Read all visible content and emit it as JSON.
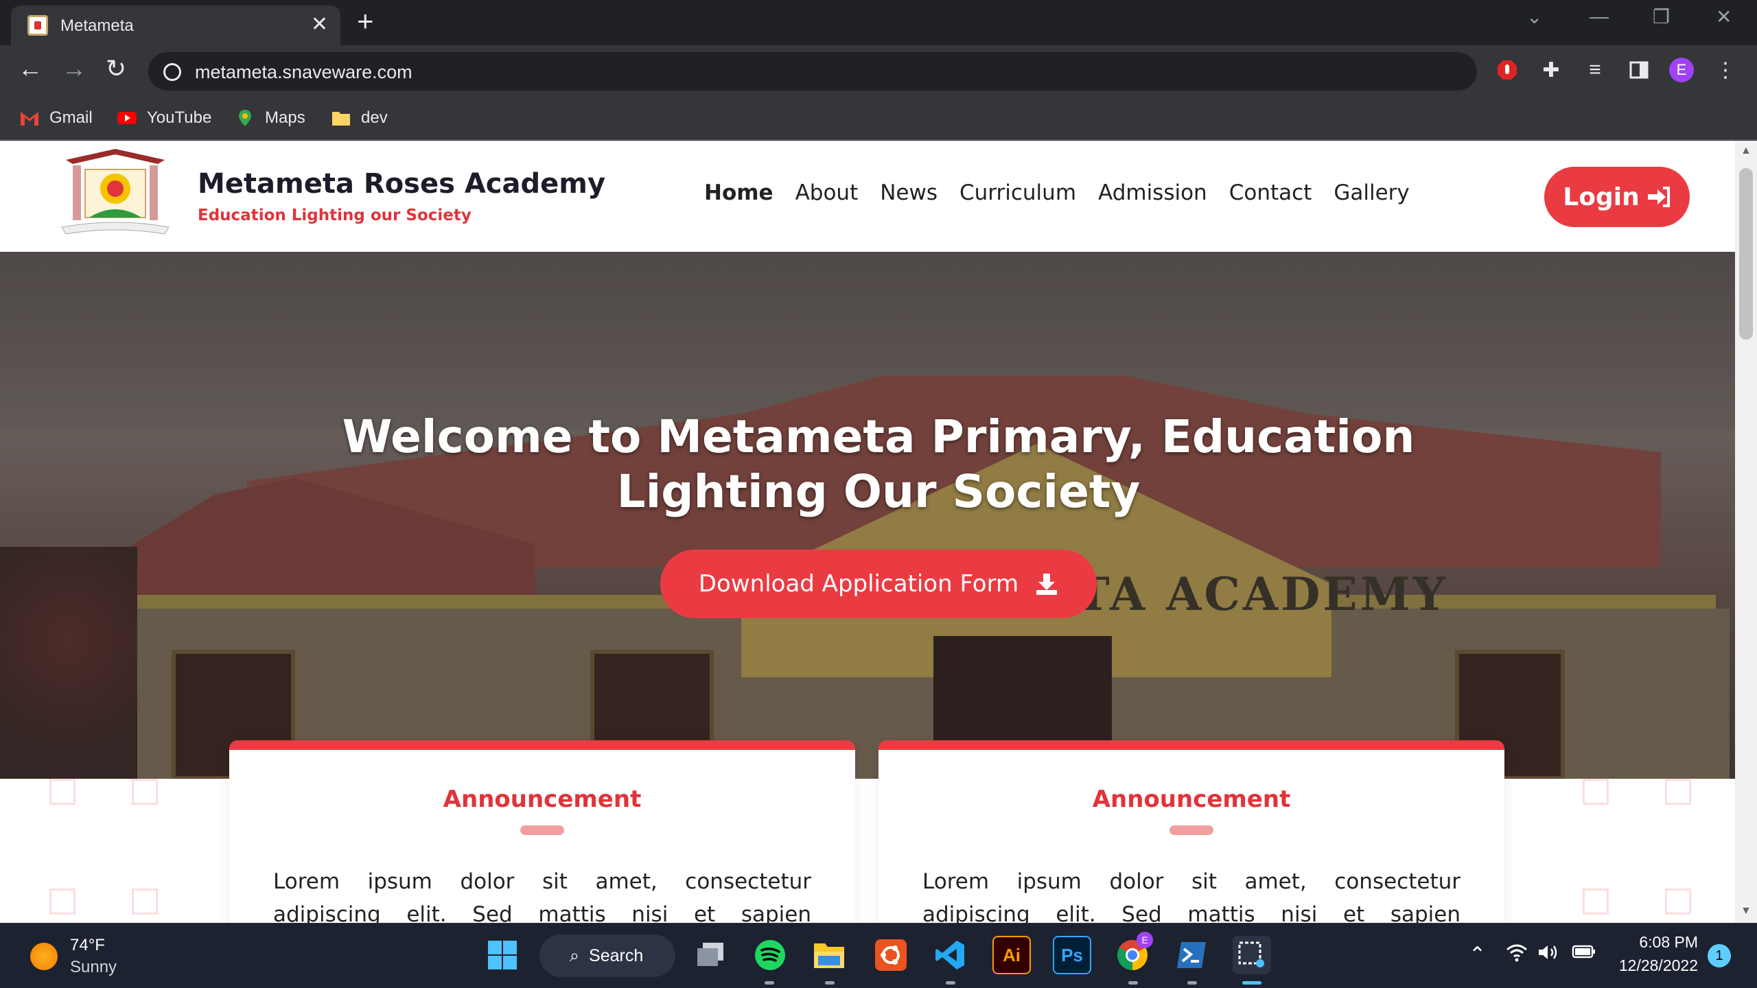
{
  "browser": {
    "tab_title": "Metameta",
    "url": "metameta.snaveware.com",
    "profile_initial": "E",
    "bookmarks": [
      {
        "label": "Gmail",
        "icon": "gmail-icon"
      },
      {
        "label": "YouTube",
        "icon": "youtube-icon"
      },
      {
        "label": "Maps",
        "icon": "maps-icon"
      },
      {
        "label": "dev",
        "icon": "folder-icon"
      }
    ]
  },
  "site": {
    "brand_name": "Metameta Roses Academy",
    "tagline": "Education Lighting our Society",
    "nav": [
      "Home",
      "About",
      "News",
      "Curriculum",
      "Admission",
      "Contact",
      "Gallery"
    ],
    "active_nav": "Home",
    "login_label": "Login",
    "hero": {
      "title": "Welcome to Metameta Primary, Education Lighting Our Society",
      "sign_text": "METAMETA ACADEMY",
      "download_label": "Download Application Form"
    },
    "cards": [
      {
        "title": "Announcement",
        "text": "Lorem ipsum dolor sit amet, consectetur adipiscing elit. Sed mattis nisi et sapien vestibulum et"
      },
      {
        "title": "Announcement",
        "text": "Lorem ipsum dolor sit amet, consectetur adipiscing elit. Sed mattis nisi et sapien vestibulum et"
      }
    ],
    "colors": {
      "accent": "#ea3b43",
      "accent_light": "#f19ea1",
      "dark_text": "#1c1c2b"
    }
  },
  "taskbar": {
    "weather_temp": "74°F",
    "weather_condition": "Sunny",
    "search_label": "Search",
    "clock_time": "6:08 PM",
    "clock_date": "12/28/2022",
    "notification_count": "1",
    "pinned_labels": {
      "illustrator": "Ai",
      "photoshop": "Ps",
      "chrome_badge": "E"
    }
  }
}
